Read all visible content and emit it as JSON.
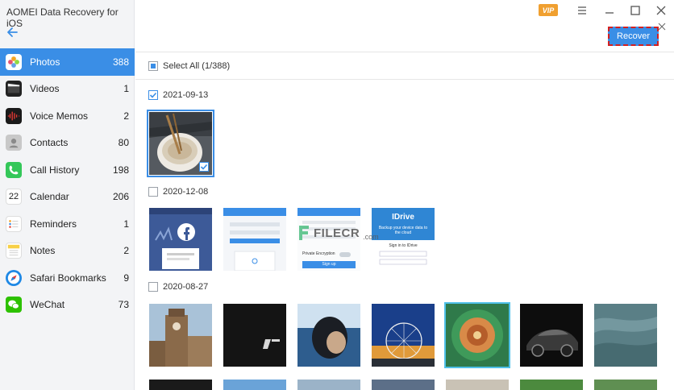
{
  "app": {
    "title": "AOMEI Data Recovery for iOS",
    "vip_label": "VIP"
  },
  "toolbar": {
    "recover_label": "Recover"
  },
  "sidebar": {
    "items": [
      {
        "label": "Photos",
        "count": "388",
        "icon": "photos-icon",
        "color": "#f5a623"
      },
      {
        "label": "Videos",
        "count": "1",
        "icon": "videos-icon",
        "color": "#222222"
      },
      {
        "label": "Voice Memos",
        "count": "2",
        "icon": "voice-memos-icon",
        "color": "#1a1a1a"
      },
      {
        "label": "Contacts",
        "count": "80",
        "icon": "contacts-icon",
        "color": "#b9b9b9"
      },
      {
        "label": "Call History",
        "count": "198",
        "icon": "call-history-icon",
        "color": "#34c759"
      },
      {
        "label": "Calendar",
        "count": "206",
        "icon": "calendar-icon",
        "color": "#ffffff"
      },
      {
        "label": "Reminders",
        "count": "1",
        "icon": "reminders-icon",
        "color": "#ffffff"
      },
      {
        "label": "Notes",
        "count": "2",
        "icon": "notes-icon",
        "color": "#f7d046"
      },
      {
        "label": "Safari Bookmarks",
        "count": "9",
        "icon": "safari-icon",
        "color": "#1e88e5"
      },
      {
        "label": "WeChat",
        "count": "73",
        "icon": "wechat-icon",
        "color": "#2dc100"
      }
    ],
    "calendar_day": "22"
  },
  "main": {
    "select_all_label": "Select All (1/388)",
    "groups": [
      {
        "date": "2021-09-13",
        "checked": true
      },
      {
        "date": "2020-12-08",
        "checked": false
      },
      {
        "date": "2020-08-27",
        "checked": false
      }
    ],
    "screenshots": {
      "idrive_brand": "IDrive",
      "idrive_tagline": "Backup your device data to the cloud",
      "idrive_signin": "Sign in to IDrive",
      "private_encryption": "Private Encryption",
      "sign_up": "Sign up"
    }
  },
  "watermark": {
    "text": "FILECR",
    "suffix": ".com"
  },
  "colors": {
    "accent": "#3a8ee6",
    "highlight_dash": "#d42020",
    "vip": "#f0a030"
  }
}
